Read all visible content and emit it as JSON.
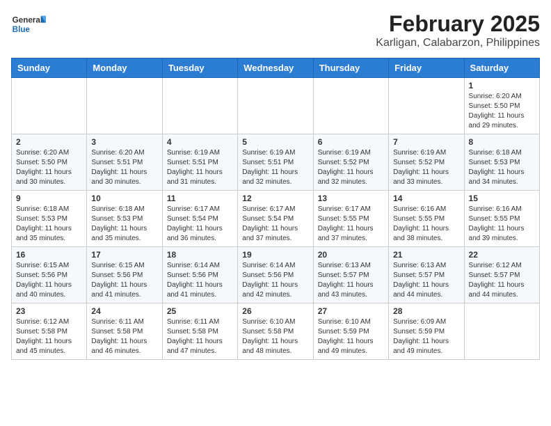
{
  "header": {
    "logo_general": "General",
    "logo_blue": "Blue",
    "title": "February 2025",
    "subtitle": "Karligan, Calabarzon, Philippines"
  },
  "days_of_week": [
    "Sunday",
    "Monday",
    "Tuesday",
    "Wednesday",
    "Thursday",
    "Friday",
    "Saturday"
  ],
  "weeks": [
    [
      {
        "day": "",
        "info": ""
      },
      {
        "day": "",
        "info": ""
      },
      {
        "day": "",
        "info": ""
      },
      {
        "day": "",
        "info": ""
      },
      {
        "day": "",
        "info": ""
      },
      {
        "day": "",
        "info": ""
      },
      {
        "day": "1",
        "info": "Sunrise: 6:20 AM\nSunset: 5:50 PM\nDaylight: 11 hours and 29 minutes."
      }
    ],
    [
      {
        "day": "2",
        "info": "Sunrise: 6:20 AM\nSunset: 5:50 PM\nDaylight: 11 hours and 30 minutes."
      },
      {
        "day": "3",
        "info": "Sunrise: 6:20 AM\nSunset: 5:51 PM\nDaylight: 11 hours and 30 minutes."
      },
      {
        "day": "4",
        "info": "Sunrise: 6:19 AM\nSunset: 5:51 PM\nDaylight: 11 hours and 31 minutes."
      },
      {
        "day": "5",
        "info": "Sunrise: 6:19 AM\nSunset: 5:51 PM\nDaylight: 11 hours and 32 minutes."
      },
      {
        "day": "6",
        "info": "Sunrise: 6:19 AM\nSunset: 5:52 PM\nDaylight: 11 hours and 32 minutes."
      },
      {
        "day": "7",
        "info": "Sunrise: 6:19 AM\nSunset: 5:52 PM\nDaylight: 11 hours and 33 minutes."
      },
      {
        "day": "8",
        "info": "Sunrise: 6:18 AM\nSunset: 5:53 PM\nDaylight: 11 hours and 34 minutes."
      }
    ],
    [
      {
        "day": "9",
        "info": "Sunrise: 6:18 AM\nSunset: 5:53 PM\nDaylight: 11 hours and 35 minutes."
      },
      {
        "day": "10",
        "info": "Sunrise: 6:18 AM\nSunset: 5:53 PM\nDaylight: 11 hours and 35 minutes."
      },
      {
        "day": "11",
        "info": "Sunrise: 6:17 AM\nSunset: 5:54 PM\nDaylight: 11 hours and 36 minutes."
      },
      {
        "day": "12",
        "info": "Sunrise: 6:17 AM\nSunset: 5:54 PM\nDaylight: 11 hours and 37 minutes."
      },
      {
        "day": "13",
        "info": "Sunrise: 6:17 AM\nSunset: 5:55 PM\nDaylight: 11 hours and 37 minutes."
      },
      {
        "day": "14",
        "info": "Sunrise: 6:16 AM\nSunset: 5:55 PM\nDaylight: 11 hours and 38 minutes."
      },
      {
        "day": "15",
        "info": "Sunrise: 6:16 AM\nSunset: 5:55 PM\nDaylight: 11 hours and 39 minutes."
      }
    ],
    [
      {
        "day": "16",
        "info": "Sunrise: 6:15 AM\nSunset: 5:56 PM\nDaylight: 11 hours and 40 minutes."
      },
      {
        "day": "17",
        "info": "Sunrise: 6:15 AM\nSunset: 5:56 PM\nDaylight: 11 hours and 41 minutes."
      },
      {
        "day": "18",
        "info": "Sunrise: 6:14 AM\nSunset: 5:56 PM\nDaylight: 11 hours and 41 minutes."
      },
      {
        "day": "19",
        "info": "Sunrise: 6:14 AM\nSunset: 5:56 PM\nDaylight: 11 hours and 42 minutes."
      },
      {
        "day": "20",
        "info": "Sunrise: 6:13 AM\nSunset: 5:57 PM\nDaylight: 11 hours and 43 minutes."
      },
      {
        "day": "21",
        "info": "Sunrise: 6:13 AM\nSunset: 5:57 PM\nDaylight: 11 hours and 44 minutes."
      },
      {
        "day": "22",
        "info": "Sunrise: 6:12 AM\nSunset: 5:57 PM\nDaylight: 11 hours and 44 minutes."
      }
    ],
    [
      {
        "day": "23",
        "info": "Sunrise: 6:12 AM\nSunset: 5:58 PM\nDaylight: 11 hours and 45 minutes."
      },
      {
        "day": "24",
        "info": "Sunrise: 6:11 AM\nSunset: 5:58 PM\nDaylight: 11 hours and 46 minutes."
      },
      {
        "day": "25",
        "info": "Sunrise: 6:11 AM\nSunset: 5:58 PM\nDaylight: 11 hours and 47 minutes."
      },
      {
        "day": "26",
        "info": "Sunrise: 6:10 AM\nSunset: 5:58 PM\nDaylight: 11 hours and 48 minutes."
      },
      {
        "day": "27",
        "info": "Sunrise: 6:10 AM\nSunset: 5:59 PM\nDaylight: 11 hours and 49 minutes."
      },
      {
        "day": "28",
        "info": "Sunrise: 6:09 AM\nSunset: 5:59 PM\nDaylight: 11 hours and 49 minutes."
      },
      {
        "day": "",
        "info": ""
      }
    ]
  ]
}
